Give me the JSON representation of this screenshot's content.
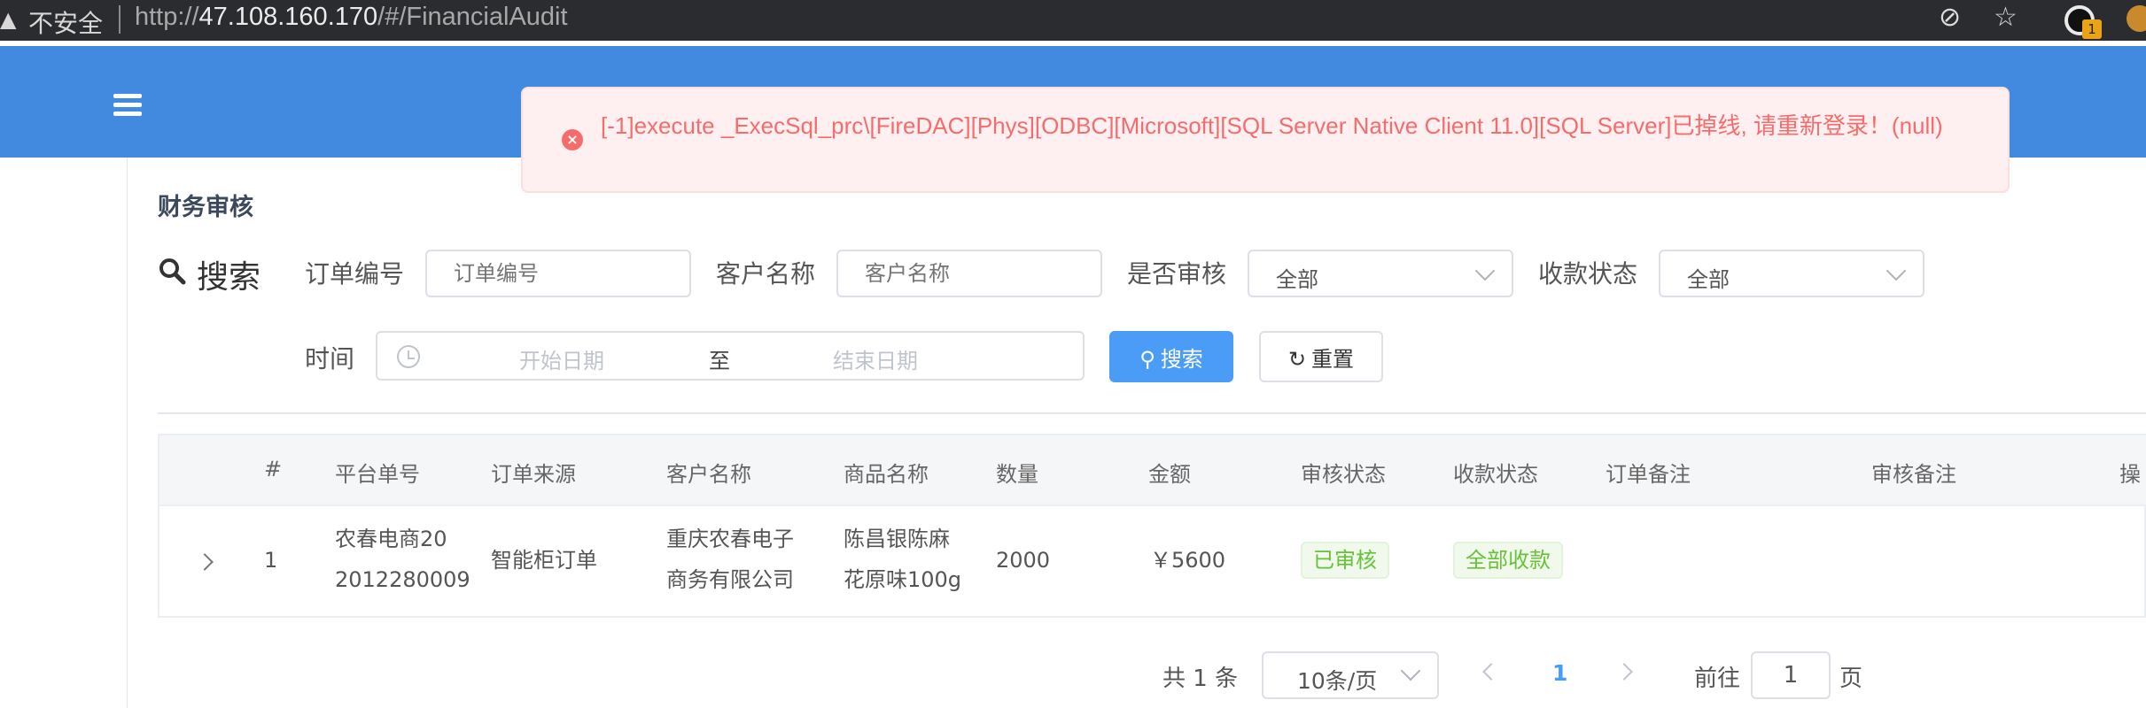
{
  "browser": {
    "insecure_label": "不安全",
    "url_scheme": "http://",
    "url_host": "47.108.160.170",
    "url_path": "/#/FinancialAudit",
    "extension_badge": "1"
  },
  "page": {
    "title": "财务审核",
    "search_title": "搜索"
  },
  "filters": {
    "order_no_label": "订单编号",
    "order_no_placeholder": "订单编号",
    "customer_label": "客户名称",
    "customer_placeholder": "客户名称",
    "audited_label": "是否审核",
    "audited_value": "全部",
    "payment_label": "收款状态",
    "payment_value": "全部",
    "time_label": "时间",
    "start_placeholder": "开始日期",
    "range_separator": "至",
    "end_placeholder": "结束日期",
    "search_button": "搜索",
    "reset_button": "重置"
  },
  "table": {
    "columns": [
      "#",
      "平台单号",
      "订单来源",
      "客户名称",
      "商品名称",
      "数量",
      "金额",
      "审核状态",
      "收款状态",
      "订单备注",
      "审核备注",
      "操"
    ],
    "rows": [
      {
        "index": "1",
        "platform_no_line1": "农春电商20",
        "platform_no_line2": "2012280009",
        "source": "智能柜订单",
        "customer_line1": "重庆农春电子",
        "customer_line2": "商务有限公司",
        "product_line1": "陈昌银陈麻",
        "product_line2": "花原味100g",
        "quantity": "2000",
        "amount": "￥5600",
        "audit_status": "已审核",
        "payment_status": "全部收款",
        "order_note": "",
        "audit_note": ""
      }
    ]
  },
  "pagination": {
    "total": "共 1 条",
    "page_size": "10条/页",
    "current_page": "1",
    "goto_label": "前往",
    "goto_value": "1",
    "page_suffix": "页"
  },
  "toast": {
    "type": "error",
    "message": "[-1]execute _ExecSql_prc\\[FireDAC][Phys][ODBC][Microsoft][SQL Server Native Client 11.0][SQL Server]已掉线, 请重新登录！(null)"
  },
  "colors": {
    "header_blue": "#4289e0",
    "primary": "#4a9cf6",
    "success": "#67c23a",
    "error": "#f56c6c",
    "browser_bar": "#2b2c30"
  }
}
